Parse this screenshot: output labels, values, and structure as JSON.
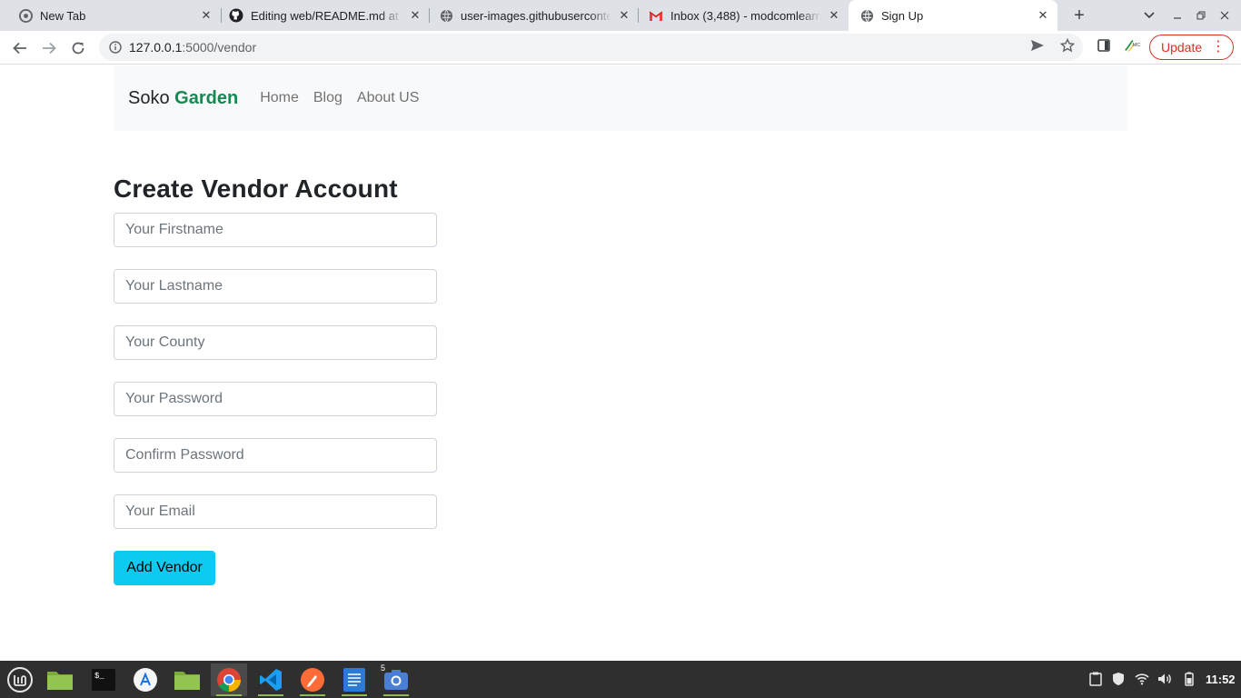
{
  "browser": {
    "tabs": [
      {
        "title": "New Tab",
        "icon": "chrome-icon",
        "active": false
      },
      {
        "title": "Editing web/README.md at",
        "icon": "github-icon",
        "active": false
      },
      {
        "title": "user-images.githubuserconte",
        "icon": "globe-icon",
        "active": false
      },
      {
        "title": "Inbox (3,488) - modcomlearn",
        "icon": "gmail-icon",
        "active": false
      },
      {
        "title": "Sign Up",
        "icon": "globe-icon",
        "active": true
      }
    ],
    "url_host": "127.0.0.1",
    "url_path": ":5000/vendor",
    "update_label": "Update"
  },
  "navbar": {
    "brand_prefix": "Soko ",
    "brand_accent": "Garden",
    "links": [
      "Home",
      "Blog",
      "About US"
    ]
  },
  "form": {
    "title": "Create Vendor Account",
    "fields": [
      {
        "placeholder": "Your Firstname",
        "value": ""
      },
      {
        "placeholder": "Your Lastname",
        "value": ""
      },
      {
        "placeholder": "Your County",
        "value": ""
      },
      {
        "placeholder": "Your Password",
        "value": ""
      },
      {
        "placeholder": "Confirm Password",
        "value": ""
      },
      {
        "placeholder": "Your Email",
        "value": ""
      }
    ],
    "submit_label": "Add Vendor"
  },
  "taskbar": {
    "apps": [
      "mint-menu-icon",
      "folder-icon",
      "terminal-icon",
      "software-manager-icon",
      "files-icon",
      "chrome-icon",
      "vscode-icon",
      "postman-icon",
      "text-editor-icon",
      "screenshot-icon"
    ],
    "screenshot_badge": "5",
    "clock": "11:52"
  },
  "colors": {
    "brand_accent": "#198754",
    "button_info": "#0dcaf0",
    "update_red": "#d93025",
    "taskbar": "#2f2f2f"
  }
}
